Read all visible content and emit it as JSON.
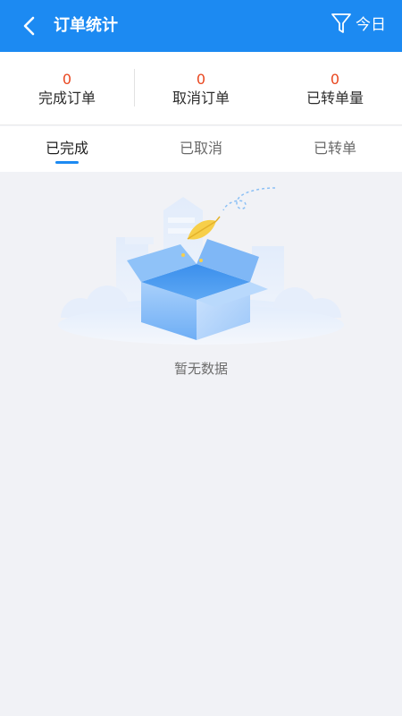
{
  "header": {
    "title": "订单统计",
    "filter_label": "今日",
    "background": "#1c8af2",
    "back_icon": "chevron-left-icon",
    "filter_icon": "funnel-icon"
  },
  "stats": [
    {
      "value": "0",
      "label": "完成订单"
    },
    {
      "value": "0",
      "label": "取消订单"
    },
    {
      "value": "0",
      "label": "已转单量"
    }
  ],
  "tabs": [
    {
      "label": "已完成",
      "active": true
    },
    {
      "label": "已取消",
      "active": false
    },
    {
      "label": "已转单",
      "active": false
    }
  ],
  "empty_state": {
    "message": "暂无数据",
    "icon": "empty-box-illustration"
  },
  "colors": {
    "accent": "#1c8af2",
    "stat_value": "#e9471f",
    "page_bg": "#f1f2f6"
  }
}
